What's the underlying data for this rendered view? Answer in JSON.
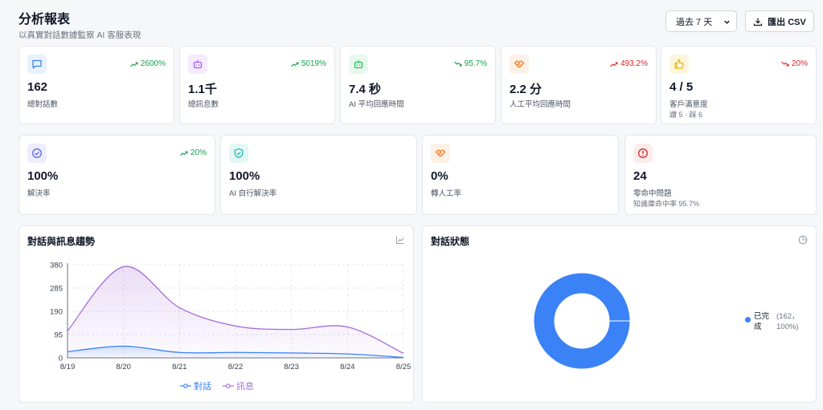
{
  "header": {
    "title": "分析報表",
    "subtitle": "以真實對話數據監察 AI 客服表現",
    "range_value": "過去 7 天",
    "export_label": "匯出 CSV"
  },
  "stats_row1": [
    {
      "value": "162",
      "label": "總對話數",
      "trend": "2600%",
      "trend_dir": "up",
      "trend_color": "#16a34a",
      "icon": "chat-bubble-icon",
      "icon_color": "#3b82f6",
      "icon_bg": "#e8f1fe"
    },
    {
      "value": "1.1千",
      "label": "總訊息數",
      "trend": "5019%",
      "trend_dir": "up",
      "trend_color": "#16a34a",
      "icon": "robot-icon",
      "icon_color": "#a855f7",
      "icon_bg": "#f5ebfe"
    },
    {
      "value": "7.4 秒",
      "label": "AI 平均回應時間",
      "trend": "95.7%",
      "trend_dir": "down",
      "trend_color": "#16a34a",
      "icon": "robot-icon",
      "icon_color": "#22c55e",
      "icon_bg": "#e8f8ee"
    },
    {
      "value": "2.2 分",
      "label": "人工平均回應時間",
      "trend": "493.2%",
      "trend_dir": "up",
      "trend_color": "#dc2626",
      "icon": "handshake-icon",
      "icon_color": "#f97316",
      "icon_bg": "#fdf0e6"
    },
    {
      "value": "4 / 5",
      "label": "客戶滿意度",
      "sub": "讚 5 · 踩 6",
      "trend": "20%",
      "trend_dir": "down",
      "trend_color": "#dc2626",
      "icon": "thumbs-up-icon",
      "icon_color": "#eab308",
      "icon_bg": "#fdf6dc"
    }
  ],
  "stats_row2": [
    {
      "value": "100%",
      "label": "解決率",
      "trend": "20%",
      "trend_dir": "up",
      "trend_color": "#16a34a",
      "icon": "check-circle-icon",
      "icon_color": "#6366f1",
      "icon_bg": "#ecedfd"
    },
    {
      "value": "100%",
      "label": "AI 自行解決率",
      "icon": "shield-check-icon",
      "icon_color": "#14b8a6",
      "icon_bg": "#e4f7f4"
    },
    {
      "value": "0%",
      "label": "轉人工率",
      "icon": "handshake-icon",
      "icon_color": "#f97316",
      "icon_bg": "#fdf0e6"
    },
    {
      "value": "24",
      "label": "零命中問題",
      "sub": "知識庫命中率 95.7%",
      "icon": "alert-circle-icon",
      "icon_color": "#dc2626",
      "icon_bg": "#fdecec"
    }
  ],
  "trend_panel": {
    "title": "對話與訊息趨勢",
    "icon": "line-chart-icon"
  },
  "status_panel": {
    "title": "對話狀態",
    "icon": "pie-chart-icon"
  },
  "chart_data": [
    {
      "type": "area",
      "title": "對話與訊息趨勢",
      "categories": [
        "8/19",
        "8/20",
        "8/21",
        "8/22",
        "8/23",
        "8/24",
        "8/25"
      ],
      "yticks": [
        0,
        95,
        190,
        285,
        380
      ],
      "ylim": [
        0,
        380
      ],
      "grid": true,
      "legend": "bottom",
      "series": [
        {
          "name": "對話",
          "color": "#3b82f6",
          "values": [
            25,
            48,
            22,
            22,
            20,
            16,
            2
          ]
        },
        {
          "name": "訊息",
          "color": "#a66cd9",
          "values": [
            110,
            372,
            205,
            130,
            116,
            126,
            18
          ]
        }
      ]
    },
    {
      "type": "pie",
      "title": "對話狀態",
      "donut": true,
      "legend": "right",
      "slices": [
        {
          "label": "已完成",
          "value": 162,
          "percent": "100%",
          "color": "#3b82f6",
          "detail": "(162，100%)"
        }
      ]
    }
  ]
}
